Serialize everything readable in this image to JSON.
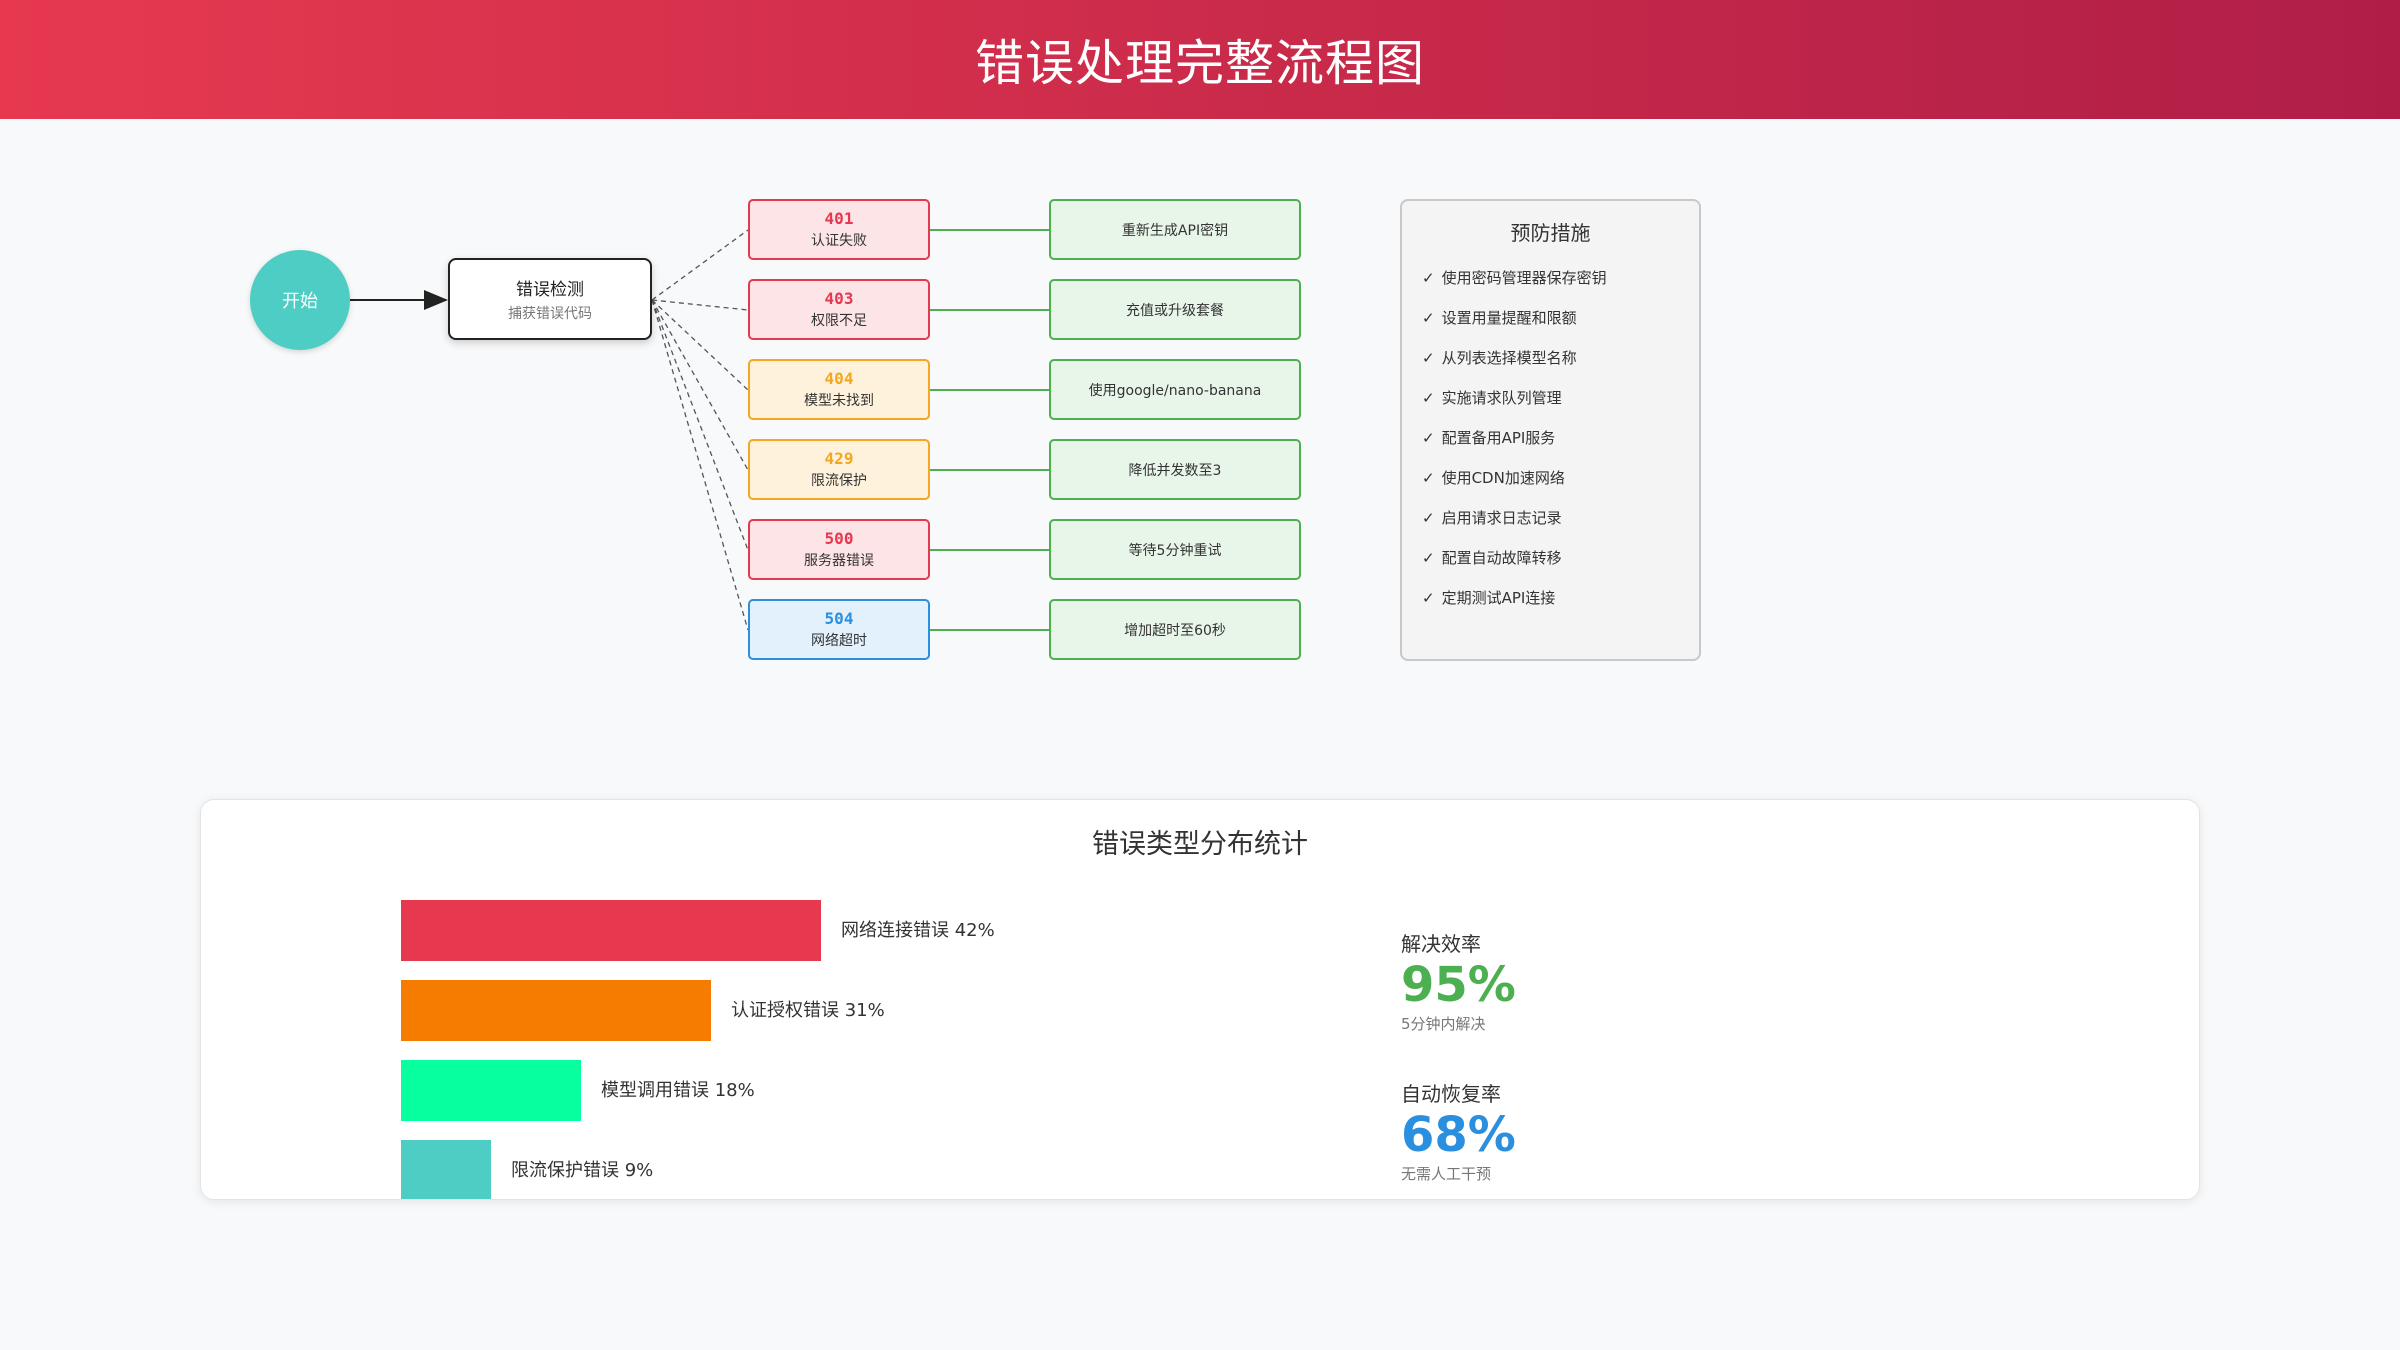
{
  "page": {
    "title": "错误处理完整流程图"
  },
  "flow": {
    "start": {
      "label": "开始"
    },
    "detect": {
      "title": "错误检测",
      "subtitle": "捕获错误代码"
    },
    "errors": [
      {
        "code": "401",
        "label": "认证失败",
        "color": "#e63950",
        "bg": "#fde4e7",
        "solution": "重新生成API密钥"
      },
      {
        "code": "403",
        "label": "权限不足",
        "color": "#e63950",
        "bg": "#fde4e7",
        "solution": "充值或升级套餐"
      },
      {
        "code": "404",
        "label": "模型未找到",
        "color": "#f5a623",
        "bg": "#fff2dc",
        "solution": "使用google/nano-banana"
      },
      {
        "code": "429",
        "label": "限流保护",
        "color": "#f5a623",
        "bg": "#fff2dc",
        "solution": "降低并发数至3"
      },
      {
        "code": "500",
        "label": "服务器错误",
        "color": "#e63950",
        "bg": "#fde4e7",
        "solution": "等待5分钟重试"
      },
      {
        "code": "504",
        "label": "网络超时",
        "color": "#2b8fe0",
        "bg": "#e3f1fd",
        "solution": "增加超时至60秒"
      }
    ],
    "solution_border": "#4caf50",
    "solution_bg": "#e8f5e9"
  },
  "prevention": {
    "title": "预防措施",
    "check": "✓",
    "items": [
      "使用密码管理器保存密钥",
      "设置用量提醒和限额",
      "从列表选择模型名称",
      "实施请求队列管理",
      "配置备用API服务",
      "使用CDN加速网络",
      "启用请求日志记录",
      "配置自动故障转移",
      "定期测试API连接"
    ]
  },
  "stats": {
    "title": "错误类型分布统计",
    "metrics": [
      {
        "label": "解决效率",
        "value": "95%",
        "sub": "5分钟内解决",
        "color": "#4caf50"
      },
      {
        "label": "自动恢复率",
        "value": "68%",
        "sub": "无需人工干预",
        "color": "#2b8fe0"
      }
    ]
  },
  "chart_data": {
    "type": "bar",
    "orientation": "horizontal",
    "categories": [
      "网络连接错误",
      "认证授权错误",
      "模型调用错误",
      "限流保护错误"
    ],
    "values": [
      42,
      31,
      18,
      9
    ],
    "labels": [
      "网络连接错误 42%",
      "认证授权错误 31%",
      "模型调用错误 18%",
      "限流保护错误 9%"
    ],
    "colors": [
      "#e63950",
      "#f57c00",
      "#08ffa0",
      "#4ecdc4"
    ],
    "unit": "%"
  }
}
